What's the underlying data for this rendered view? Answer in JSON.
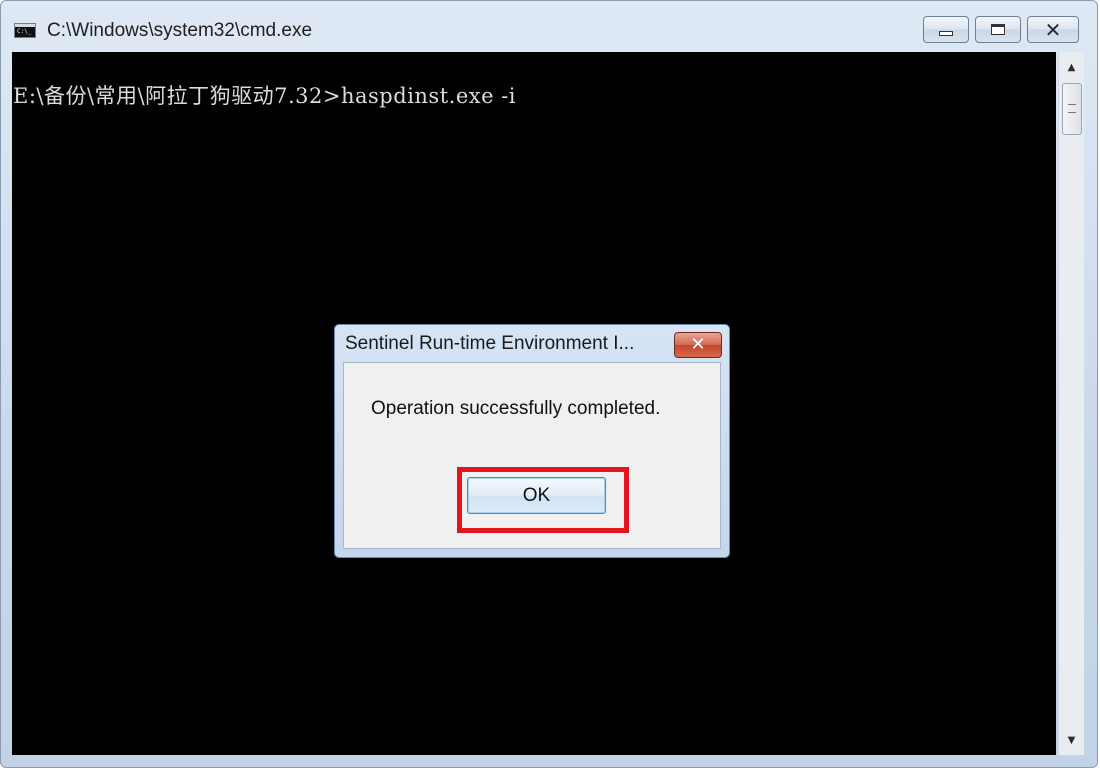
{
  "window": {
    "title": "C:\\Windows\\system32\\cmd.exe",
    "minimize_icon": "minimize-icon",
    "maximize_icon": "restore-icon",
    "close_icon": "close-icon"
  },
  "console": {
    "lines": [
      "E:\\备份\\常用\\阿拉丁狗驱动7.32>haspdinst.exe -i"
    ],
    "background": "#000000",
    "foreground": "#dcdcdc"
  },
  "scrollbar": {
    "up_icon": "scroll-up-arrow-icon",
    "down_icon": "scroll-down-arrow-icon"
  },
  "dialog": {
    "title": "Sentinel Run-time Environment I...",
    "message": "Operation successfully completed.",
    "ok_label": "OK",
    "close_icon": "close-icon",
    "highlight_color": "#e3141b"
  }
}
